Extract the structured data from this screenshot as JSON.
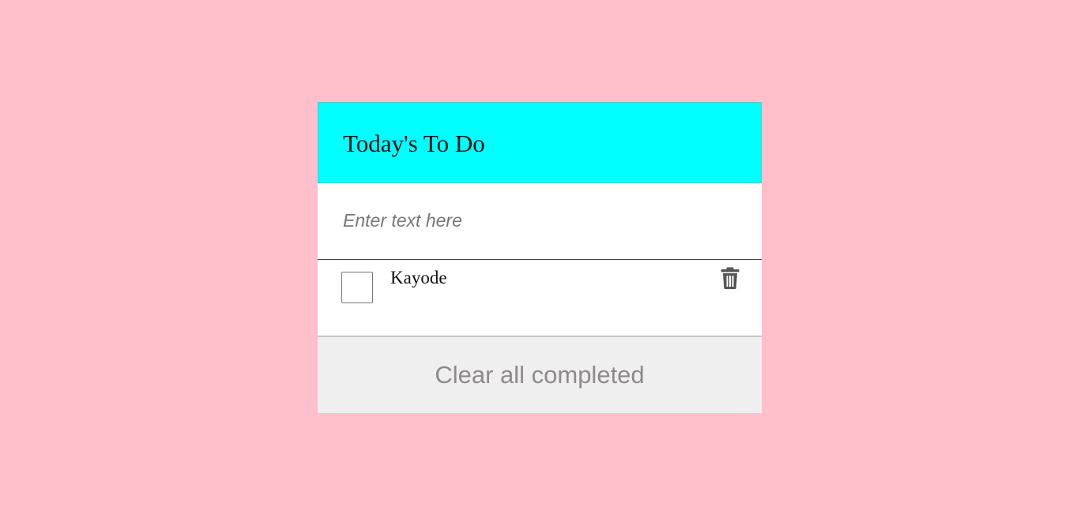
{
  "header": {
    "title": "Today's To Do"
  },
  "input": {
    "placeholder": "Enter text here",
    "value": ""
  },
  "tasks": [
    {
      "label": "Kayode",
      "completed": false,
      "delete_icon": "trash-icon"
    }
  ],
  "footer": {
    "clear_label": "Clear all completed"
  },
  "colors": {
    "background": "#ffc0cb",
    "header": "#00ffff",
    "card": "#ffffff",
    "footer": "#efefef",
    "footer_text": "#8f8a8a",
    "icon": "#555555"
  }
}
